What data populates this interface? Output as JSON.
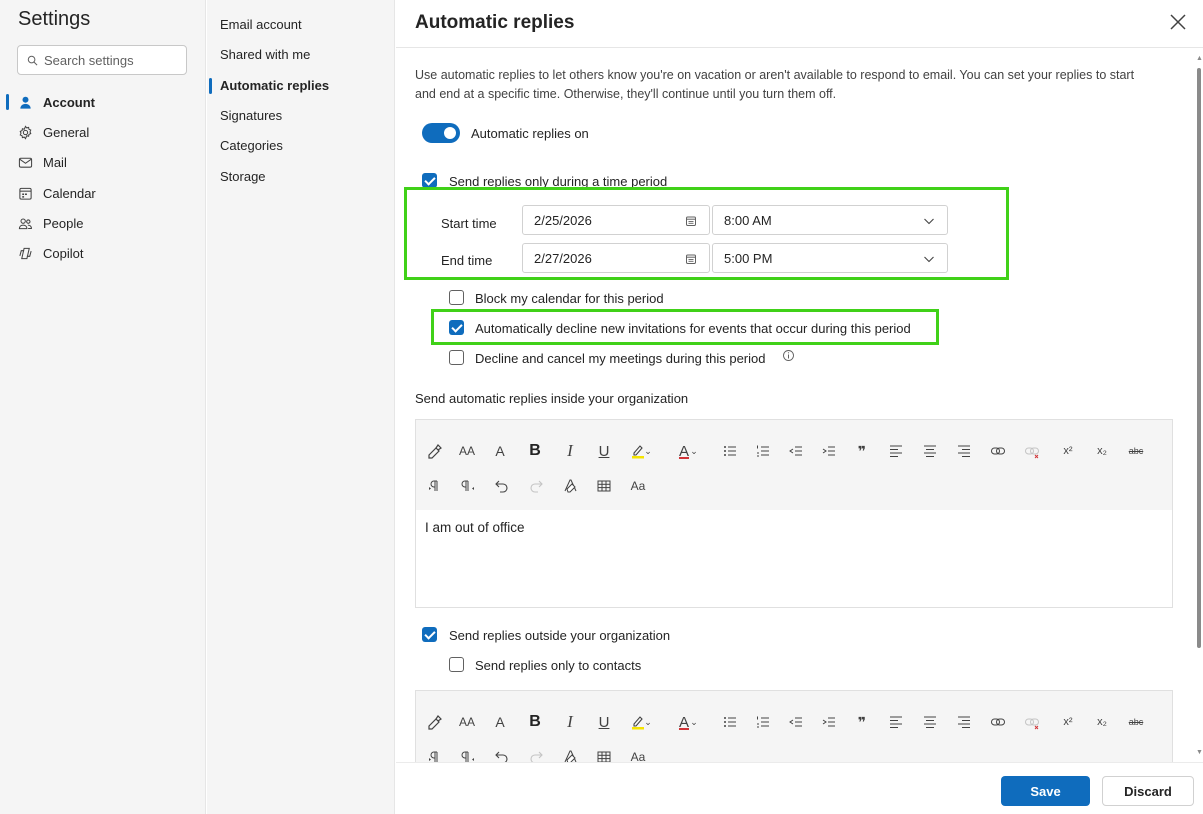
{
  "settings": {
    "title": "Settings",
    "search_placeholder": "Search settings",
    "items": [
      {
        "label": "Account",
        "icon": "person-icon"
      },
      {
        "label": "General",
        "icon": "gear-icon"
      },
      {
        "label": "Mail",
        "icon": "mail-icon"
      },
      {
        "label": "Calendar",
        "icon": "calendar-icon"
      },
      {
        "label": "People",
        "icon": "people-icon"
      },
      {
        "label": "Copilot",
        "icon": "copilot-icon"
      }
    ],
    "active": "Account"
  },
  "account_nav": {
    "items": [
      {
        "label": "Email account"
      },
      {
        "label": "Shared with me"
      },
      {
        "label": "Automatic replies"
      },
      {
        "label": "Signatures"
      },
      {
        "label": "Categories"
      },
      {
        "label": "Storage"
      }
    ],
    "active": "Automatic replies"
  },
  "panel": {
    "title": "Automatic replies",
    "description": "Use automatic replies to let others know you're on vacation or aren't available to respond to email. You can set your replies to start and end at a specific time. Otherwise, they'll continue until you turn them off.",
    "toggle_label": "Automatic replies on",
    "toggle_on": true,
    "time_period_label": "Send replies only during a time period",
    "time_period_checked": true,
    "start_label": "Start time",
    "start_date": "2/25/2026",
    "start_time": "8:00 AM",
    "end_label": "End time",
    "end_date": "2/27/2026",
    "end_time": "5:00 PM",
    "options": [
      {
        "label": "Block my calendar for this period",
        "checked": false
      },
      {
        "label": "Automatically decline new invitations for events that occur during this period",
        "checked": true
      },
      {
        "label": "Decline and cancel my meetings during this period",
        "checked": false
      }
    ],
    "inside_label": "Send automatic replies inside your organization",
    "inside_message": "I am out of office",
    "outside_label": "Send replies outside your organization",
    "outside_checked": true,
    "contacts_label": "Send replies only to contacts",
    "contacts_checked": false
  },
  "toolbar_labels": {
    "font_size": "AA",
    "grow": "A",
    "bold": "B",
    "italic": "I",
    "underline": "U",
    "font_color": "A",
    "quote": "❞",
    "superscript": "x²",
    "subscript": "x₂",
    "strike": "abc",
    "case": "Aa"
  },
  "buttons": {
    "save": "Save",
    "discard": "Discard"
  },
  "colors": {
    "accent": "#0f6cbd",
    "highlight_box": "#40d118"
  }
}
